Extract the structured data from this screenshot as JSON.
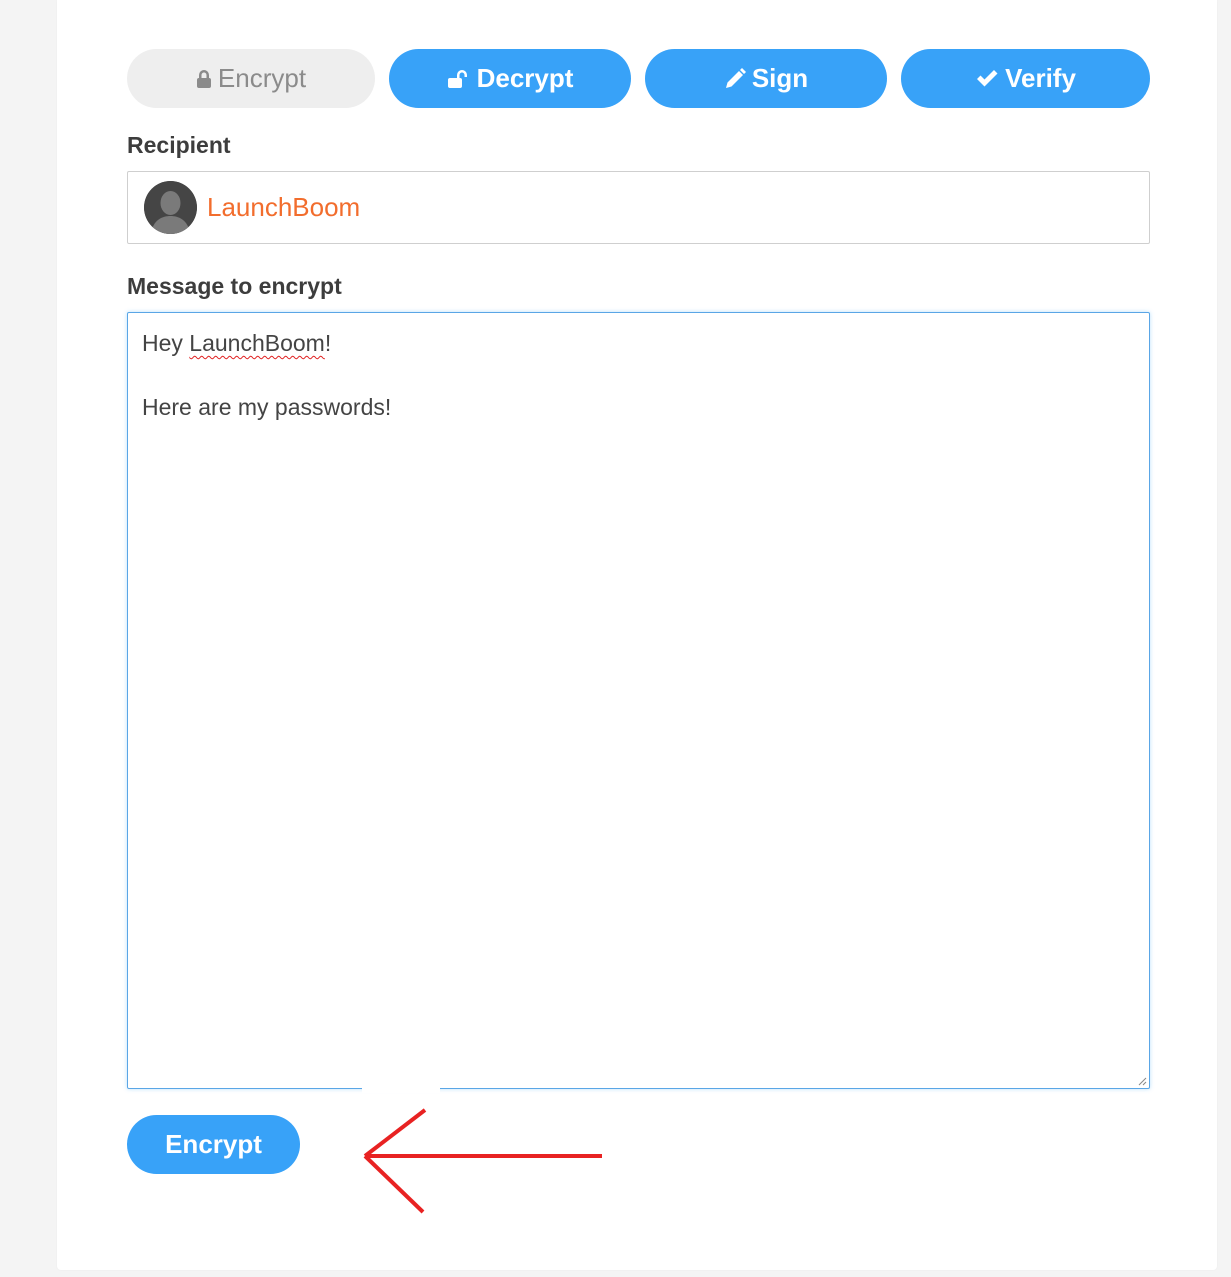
{
  "tabs": [
    {
      "label": "Encrypt",
      "icon": "lock-icon",
      "active": true
    },
    {
      "label": "Decrypt",
      "icon": "unlock-icon",
      "active": false
    },
    {
      "label": "Sign",
      "icon": "pencil-icon",
      "active": false
    },
    {
      "label": "Verify",
      "icon": "check-icon",
      "active": false
    }
  ],
  "recipient": {
    "label": "Recipient",
    "name": "LaunchBoom",
    "avatar_icon": "user-avatar-icon"
  },
  "message": {
    "label": "Message to encrypt",
    "lines": [
      "Hey LaunchBoom!",
      "",
      "Here are my passwords!"
    ]
  },
  "submit": {
    "label": "Encrypt"
  },
  "colors": {
    "accent": "#38a2f8",
    "active_tab_bg": "#eeeeee",
    "recipient_name": "#f26d2d",
    "annotation_arrow": "#e82222"
  }
}
